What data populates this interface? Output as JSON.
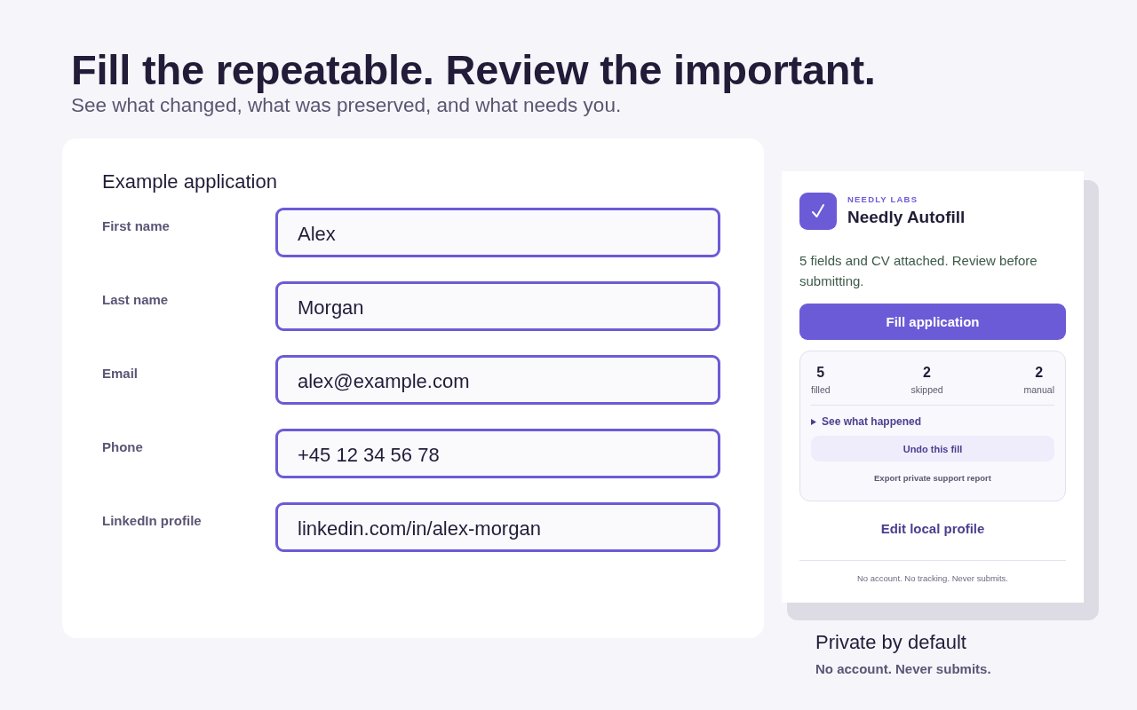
{
  "hero": {
    "title": "Fill the repeatable. Review the important.",
    "subtitle": "See what changed, what was preserved, and what needs you."
  },
  "form": {
    "title": "Example application",
    "fields": [
      {
        "label": "First name",
        "value": "Alex"
      },
      {
        "label": "Last name",
        "value": "Morgan"
      },
      {
        "label": "Email",
        "value": "alex@example.com"
      },
      {
        "label": "Phone",
        "value": "+45 12 34 56 78"
      },
      {
        "label": "LinkedIn profile",
        "value": "linkedin.com/in/alex-morgan"
      }
    ]
  },
  "extension": {
    "brand": "NEEDLY LABS",
    "name": "Needly Autofill",
    "status": "5 fields and CV attached. Review before submitting.",
    "primary_button": "Fill application",
    "stats": [
      {
        "value": "5",
        "label": "filled"
      },
      {
        "value": "2",
        "label": "skipped"
      },
      {
        "value": "2",
        "label": "manual"
      }
    ],
    "details_toggle": {
      "label": "See what happened",
      "expanded": false
    },
    "undo_button": "Undo this fill",
    "export_link": "Export private support report",
    "edit_link": "Edit local profile",
    "footer": "No account. No tracking. Never submits."
  },
  "privacy": {
    "title": "Private by default",
    "note": "No account. Never submits."
  }
}
